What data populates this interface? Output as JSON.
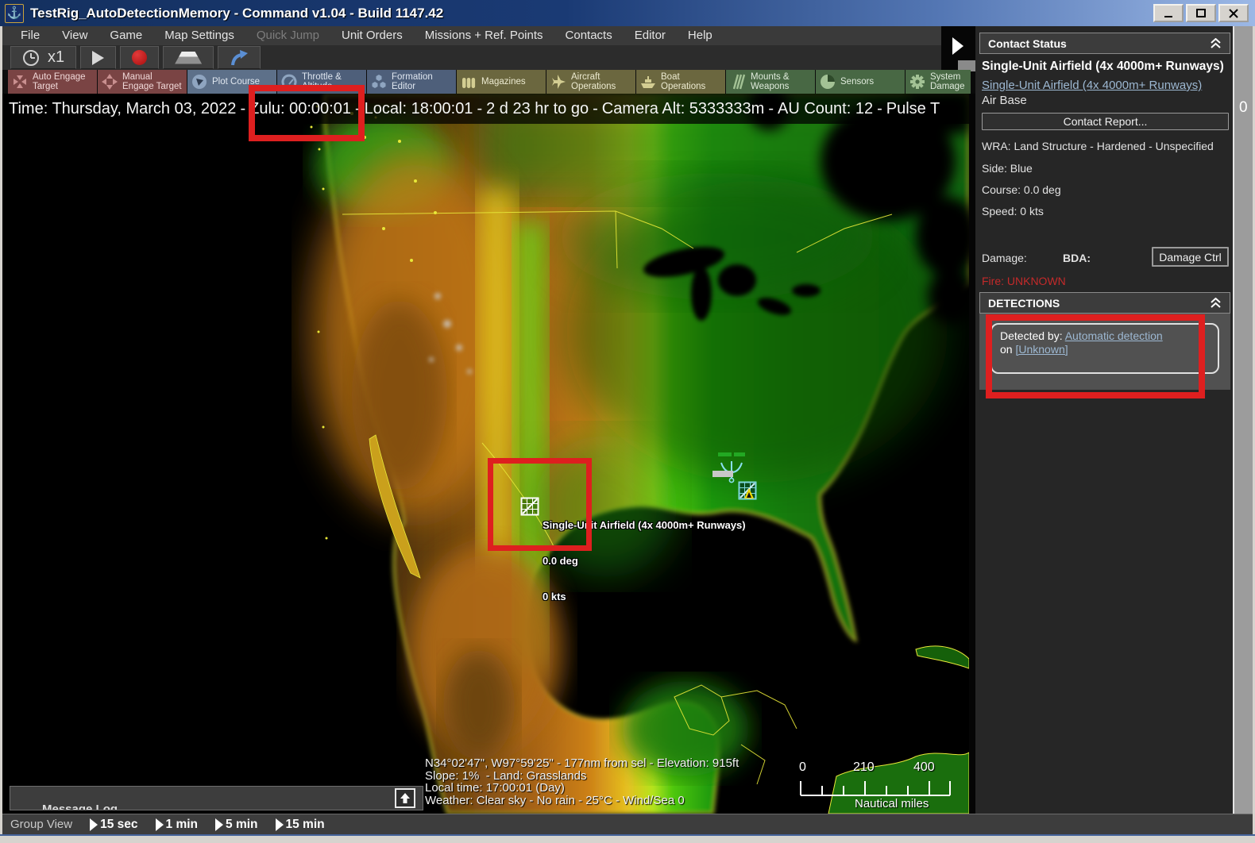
{
  "window": {
    "title": "TestRig_AutoDetectionMemory - Command v1.04 - Build 1147.42"
  },
  "menu": {
    "items": [
      {
        "label": "File"
      },
      {
        "label": "View"
      },
      {
        "label": "Game"
      },
      {
        "label": "Map Settings"
      },
      {
        "label": "Quick Jump",
        "disabled": true
      },
      {
        "label": "Unit Orders"
      },
      {
        "label": "Missions + Ref. Points"
      },
      {
        "label": "Contacts"
      },
      {
        "label": "Editor"
      },
      {
        "label": "Help"
      }
    ]
  },
  "toolbar": {
    "speed_label": "x1"
  },
  "tabs": [
    {
      "label": "Auto Engage Target",
      "group": "red"
    },
    {
      "label": "Manual Engage Target",
      "group": "red"
    },
    {
      "label": "Plot Course",
      "group": "blue"
    },
    {
      "label": "Throttle & Altitude",
      "group": "blue"
    },
    {
      "label": "Formation Editor",
      "group": "blue"
    },
    {
      "label": "Magazines",
      "group": "olive"
    },
    {
      "label": "Aircraft Operations",
      "group": "olive"
    },
    {
      "label": "Boat Operations",
      "group": "olive"
    },
    {
      "label": "Mounts & Weapons",
      "group": "green"
    },
    {
      "label": "Sensors",
      "group": "green"
    },
    {
      "label": "System Damage",
      "group": "green"
    }
  ],
  "time_bar": {
    "date": "Time: Thursday, March 03, 2022",
    "zulu": "Zulu: 00:00:01",
    "local": "Local: 18:00:01",
    "remaining": "2 d 23 hr to go",
    "camera_alt": "Camera Alt: 5333333m",
    "au_count": "AU Count: 12",
    "tail": "Pulse T",
    "sep": "-",
    "clipped_fragment": "0"
  },
  "map": {
    "selected_unit": {
      "name": "Single-Unit Airfield (4x 4000m+ Runways)",
      "course": "0.0 deg",
      "speed": "0 kts"
    },
    "cursor_info": {
      "line1": "N34°02'47\", W97°59'25\" - 177nm from sel - Elevation: 915ft",
      "line2": "Slope: 1%  - Land: Grasslands",
      "line3": "Local time: 17:00:01 (Day)",
      "line4": "Weather: Clear sky - No rain - 25°C - Wind/Sea 0"
    },
    "scale_bar": {
      "t0": "0",
      "t1": "210",
      "t2": "400",
      "unit": "Nautical miles"
    },
    "message_log_label": "Message Log"
  },
  "contact_panel": {
    "header": "Contact Status",
    "name": "Single-Unit Airfield (4x 4000m+ Runways)",
    "name_link": "Single-Unit Airfield (4x 4000m+ Runways)",
    "type": "Air Base",
    "contact_report_button": "Contact Report...",
    "wra": "WRA: Land Structure - Hardened - Unspecified",
    "side": "Side: Blue",
    "course": "Course: 0.0 deg",
    "speed": "Speed: 0 kts",
    "damage_label": "Damage:",
    "bda_label": "BDA:",
    "damage_ctrl_button": "Damage Ctrl",
    "fire_status": "Fire: UNKNOWN",
    "detections_header": "DETECTIONS",
    "detection": {
      "prefix": "Detected by: ",
      "sensor_link": "Automatic detection",
      "on_word": "on ",
      "contact_link": "[Unknown]"
    }
  },
  "status_bar": {
    "group_view": "Group View",
    "intervals": [
      {
        "label": "15 sec"
      },
      {
        "label": "1 min"
      },
      {
        "label": "5 min"
      },
      {
        "label": "15 min"
      }
    ]
  },
  "colors": {
    "annotation_red": "#de1f1f",
    "fire_warning_red": "#c42a2a",
    "panel_link_blue": "#9db8d2",
    "titlebar_left": "#14305f",
    "titlebar_right": "#9cb8e6",
    "tab_red": "#7a4444",
    "tab_blue": "#4e5f7a",
    "tab_olive": "#6b673f",
    "tab_green": "#486844",
    "side_blue": "Blue"
  },
  "icons": {
    "app": "anchor-emblem",
    "clock": "clock-face",
    "play": "play-triangle",
    "record": "record-dot",
    "map3d": "tilted-plane",
    "jump": "curved-arrow",
    "panel_expand": "right-triangle",
    "collapse": "double-chevron-up",
    "message_log_restore": "up-arrow",
    "interval_marker": "play-triangle",
    "airfield_symbol": "grid-square-diagonal"
  }
}
